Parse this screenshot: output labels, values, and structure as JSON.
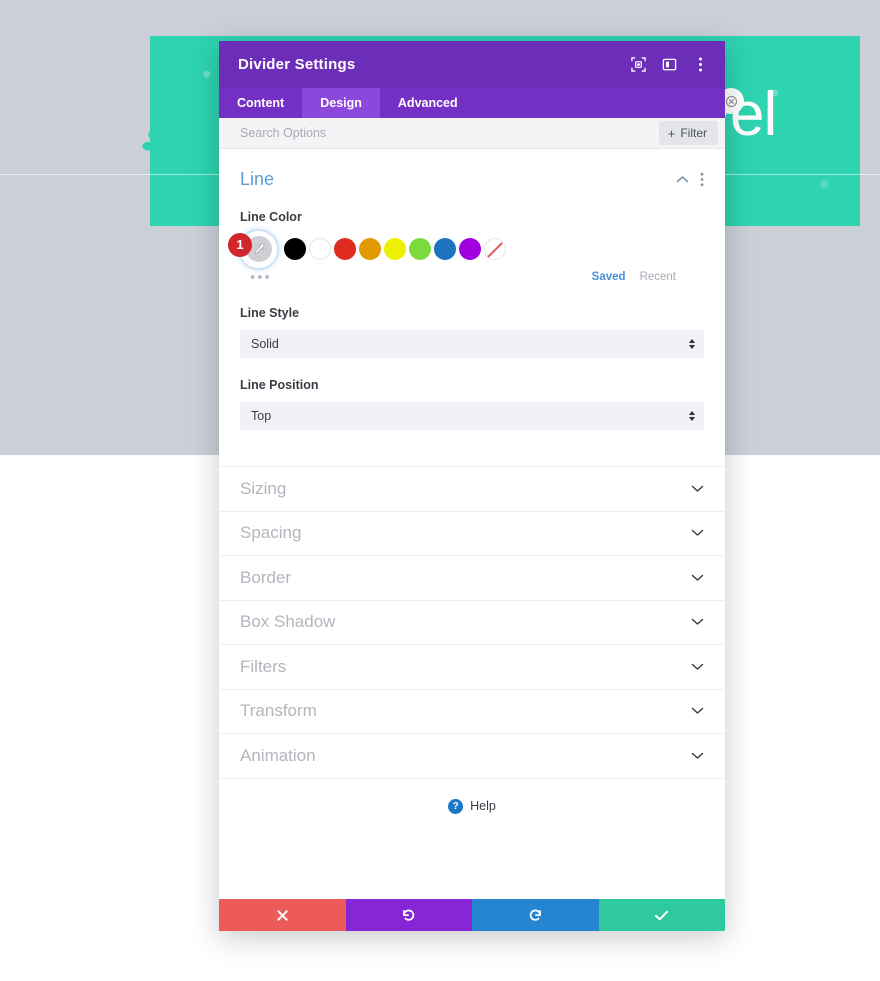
{
  "background": {
    "hero_word": "vel",
    "brush_color": "#2ed3b0",
    "page_top_color": "#cbd0d8",
    "close_badge_icon": "close-circle-icon"
  },
  "modal": {
    "title": "Divider Settings",
    "header_icons": [
      {
        "name": "fullscreen-target-icon",
        "label": "Fullscreen"
      },
      {
        "name": "layout-panel-icon",
        "label": "Panel Layout"
      },
      {
        "name": "kebab-menu-icon",
        "label": "More Options"
      }
    ],
    "tabs": [
      {
        "label": "Content",
        "active": false
      },
      {
        "label": "Design",
        "active": true
      },
      {
        "label": "Advanced",
        "active": false
      }
    ],
    "search": {
      "placeholder": "Search Options",
      "value": "",
      "filter_label": "Filter",
      "filter_plus": "+"
    },
    "accent_purple": "#6c2eb9",
    "tabbar_purple": "#7430c4",
    "tab_active_purple": "#8c47dc"
  },
  "line_section": {
    "title": "Line",
    "collapse_icon": "chevron-up-icon",
    "menu_icon": "kebab-menu-icon",
    "color_field_label": "Line Color",
    "picker": {
      "badge": "1",
      "icon": "eyedropper-icon"
    },
    "swatches": [
      {
        "name": "swatch-black",
        "color": "#000000"
      },
      {
        "name": "swatch-white",
        "color": "#ffffff"
      },
      {
        "name": "swatch-red",
        "color": "#e02b20"
      },
      {
        "name": "swatch-orange",
        "color": "#e09900"
      },
      {
        "name": "swatch-yellow",
        "color": "#edf000"
      },
      {
        "name": "swatch-green",
        "color": "#7cdb3c"
      },
      {
        "name": "swatch-blue",
        "color": "#1e73be"
      },
      {
        "name": "swatch-purple",
        "color": "#a000e0"
      },
      {
        "name": "swatch-transparent",
        "color": "transparent"
      }
    ],
    "more_dots": "•••",
    "saved_label": "Saved",
    "recent_label": "Recent",
    "style_label": "Line Style",
    "style_value": "Solid",
    "position_label": "Line Position",
    "position_value": "Top"
  },
  "collapsed_sections": [
    {
      "label": "Sizing"
    },
    {
      "label": "Spacing"
    },
    {
      "label": "Border"
    },
    {
      "label": "Box Shadow"
    },
    {
      "label": "Filters"
    },
    {
      "label": "Transform"
    },
    {
      "label": "Animation"
    }
  ],
  "help": {
    "icon_glyph": "?",
    "label": "Help"
  },
  "footer_buttons": [
    {
      "name": "cancel-button",
      "icon": "close-x-icon",
      "color": "#ed5a5a"
    },
    {
      "name": "undo-button",
      "icon": "undo-arrow-icon",
      "color": "#8726d6"
    },
    {
      "name": "redo-button",
      "icon": "redo-arrow-icon",
      "color": "#2585d1"
    },
    {
      "name": "save-button",
      "icon": "checkmark-icon",
      "color": "#2ec99e"
    }
  ]
}
